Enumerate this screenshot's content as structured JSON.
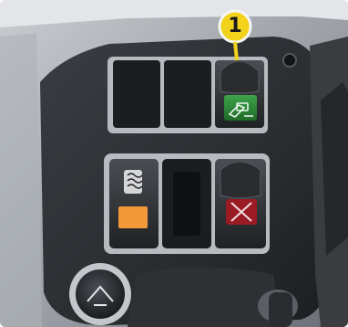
{
  "callout": {
    "label": "1"
  },
  "scene": {
    "subject": "vehicle-console-rocker-switch-panel",
    "callout_color": "#f2d21b",
    "green_switch_color": "#2f8a3a",
    "amber_switch_color": "#f29a3a",
    "red_switch_color": "#9a1b24"
  },
  "icons": {
    "top_right_switch": "blower-fan-icon",
    "lower_left_switch": "seat-heater-icon",
    "lower_right_switch": "x-disabled-icon",
    "round_knob": "knob-icon"
  }
}
